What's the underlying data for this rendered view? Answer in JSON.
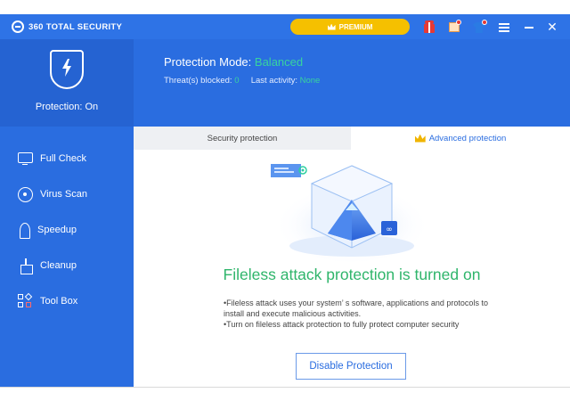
{
  "app": {
    "title": "360 TOTAL SECURITY"
  },
  "titlebar": {
    "premium_label": "PREMIUM",
    "icons": [
      "gift-icon",
      "message-icon",
      "skin-icon",
      "menu-icon",
      "minimize-icon",
      "close-icon"
    ],
    "close_glyph": "✕"
  },
  "status": {
    "protection_label": "Protection: On",
    "mode_label": "Protection Mode:",
    "mode_value": "Balanced",
    "threats_label": "Threat(s) blocked:",
    "threats_value": "0",
    "activity_label": "Last activity:",
    "activity_value": "None"
  },
  "sidebar": {
    "items": [
      {
        "label": "Full Check",
        "icon": "monitor-icon"
      },
      {
        "label": "Virus Scan",
        "icon": "scan-icon"
      },
      {
        "label": "Speedup",
        "icon": "rocket-icon"
      },
      {
        "label": "Cleanup",
        "icon": "broom-icon"
      },
      {
        "label": "Tool Box",
        "icon": "toolbox-icon"
      }
    ]
  },
  "tabs": [
    {
      "label": "Security protection",
      "active": false
    },
    {
      "label": "Advanced protection",
      "active": true
    }
  ],
  "content": {
    "headline": "Fileless attack protection is turned on",
    "bullet_1": "•Fileless attack uses your system’ s software, applications and protocols to install and execute malicious activities.",
    "bullet_2": "•Turn on fileless attack protection to fully protect computer security",
    "button_label": "Disable Protection"
  },
  "colors": {
    "brand_blue": "#2a6de0",
    "accent_green": "#2fb56b",
    "status_green": "#38d39f",
    "premium_gold": "#f5c000"
  }
}
